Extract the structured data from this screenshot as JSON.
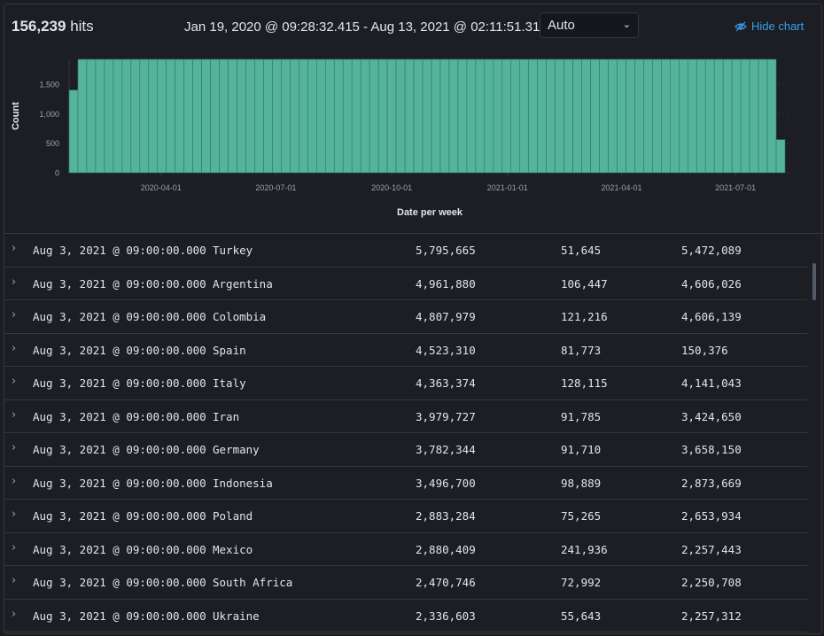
{
  "header": {
    "hits_count": "156,239",
    "hits_label": "hits",
    "time_range": "Jan 19, 2020 @ 09:28:32.415 - Aug 13, 2021 @ 02:11:51.310",
    "interval_value": "Auto",
    "hide_chart_label": "Hide chart"
  },
  "colors": {
    "bar": "#54b399",
    "accent_link": "#36a2ef",
    "background": "#1d1e24"
  },
  "chart_data": {
    "type": "bar",
    "ylabel": "Count",
    "xlabel": "Date per week",
    "ylim": [
      0,
      1920
    ],
    "yticks": [
      {
        "label": "0",
        "value": 0
      },
      {
        "label": "500",
        "value": 500
      },
      {
        "label": "1,000",
        "value": 1000
      },
      {
        "label": "1,500",
        "value": 1500
      }
    ],
    "xticks": [
      {
        "label": "2020-04-01",
        "week": 10.4
      },
      {
        "label": "2020-07-01",
        "week": 23.4
      },
      {
        "label": "2020-10-01",
        "week": 36.5
      },
      {
        "label": "2021-01-01",
        "week": 49.6
      },
      {
        "label": "2021-04-01",
        "week": 62.5
      },
      {
        "label": "2021-07-01",
        "week": 75.4
      }
    ],
    "first_week": "2020-01-19",
    "values": [
      1400,
      1920,
      1920,
      1920,
      1920,
      1920,
      1920,
      1920,
      1920,
      1920,
      1920,
      1920,
      1920,
      1920,
      1920,
      1920,
      1920,
      1920,
      1920,
      1920,
      1920,
      1920,
      1920,
      1920,
      1920,
      1920,
      1920,
      1920,
      1920,
      1920,
      1920,
      1920,
      1920,
      1920,
      1920,
      1920,
      1920,
      1920,
      1920,
      1920,
      1920,
      1920,
      1920,
      1920,
      1920,
      1920,
      1920,
      1920,
      1920,
      1920,
      1920,
      1920,
      1920,
      1920,
      1920,
      1920,
      1920,
      1920,
      1920,
      1920,
      1920,
      1920,
      1920,
      1920,
      1920,
      1920,
      1920,
      1920,
      1920,
      1920,
      1920,
      1920,
      1920,
      1920,
      1920,
      1920,
      1920,
      1920,
      1920,
      1920,
      560
    ]
  },
  "table": {
    "rows": [
      {
        "time": "Aug 3, 2021 @ 09:00:00.000",
        "country": "Turkey",
        "v1": "5,795,665",
        "v2": "51,645",
        "v3": "5,472,089"
      },
      {
        "time": "Aug 3, 2021 @ 09:00:00.000",
        "country": "Argentina",
        "v1": "4,961,880",
        "v2": "106,447",
        "v3": "4,606,026"
      },
      {
        "time": "Aug 3, 2021 @ 09:00:00.000",
        "country": "Colombia",
        "v1": "4,807,979",
        "v2": "121,216",
        "v3": "4,606,139"
      },
      {
        "time": "Aug 3, 2021 @ 09:00:00.000",
        "country": "Spain",
        "v1": "4,523,310",
        "v2": "81,773",
        "v3": "150,376"
      },
      {
        "time": "Aug 3, 2021 @ 09:00:00.000",
        "country": "Italy",
        "v1": "4,363,374",
        "v2": "128,115",
        "v3": "4,141,043"
      },
      {
        "time": "Aug 3, 2021 @ 09:00:00.000",
        "country": "Iran",
        "v1": "3,979,727",
        "v2": "91,785",
        "v3": "3,424,650"
      },
      {
        "time": "Aug 3, 2021 @ 09:00:00.000",
        "country": "Germany",
        "v1": "3,782,344",
        "v2": "91,710",
        "v3": "3,658,150"
      },
      {
        "time": "Aug 3, 2021 @ 09:00:00.000",
        "country": "Indonesia",
        "v1": "3,496,700",
        "v2": "98,889",
        "v3": "2,873,669"
      },
      {
        "time": "Aug 3, 2021 @ 09:00:00.000",
        "country": "Poland",
        "v1": "2,883,284",
        "v2": "75,265",
        "v3": "2,653,934"
      },
      {
        "time": "Aug 3, 2021 @ 09:00:00.000",
        "country": "Mexico",
        "v1": "2,880,409",
        "v2": "241,936",
        "v3": "2,257,443"
      },
      {
        "time": "Aug 3, 2021 @ 09:00:00.000",
        "country": "South Africa",
        "v1": "2,470,746",
        "v2": "72,992",
        "v3": "2,250,708"
      },
      {
        "time": "Aug 3, 2021 @ 09:00:00.000",
        "country": "Ukraine",
        "v1": "2,336,603",
        "v2": "55,643",
        "v3": "2,257,312"
      }
    ]
  }
}
